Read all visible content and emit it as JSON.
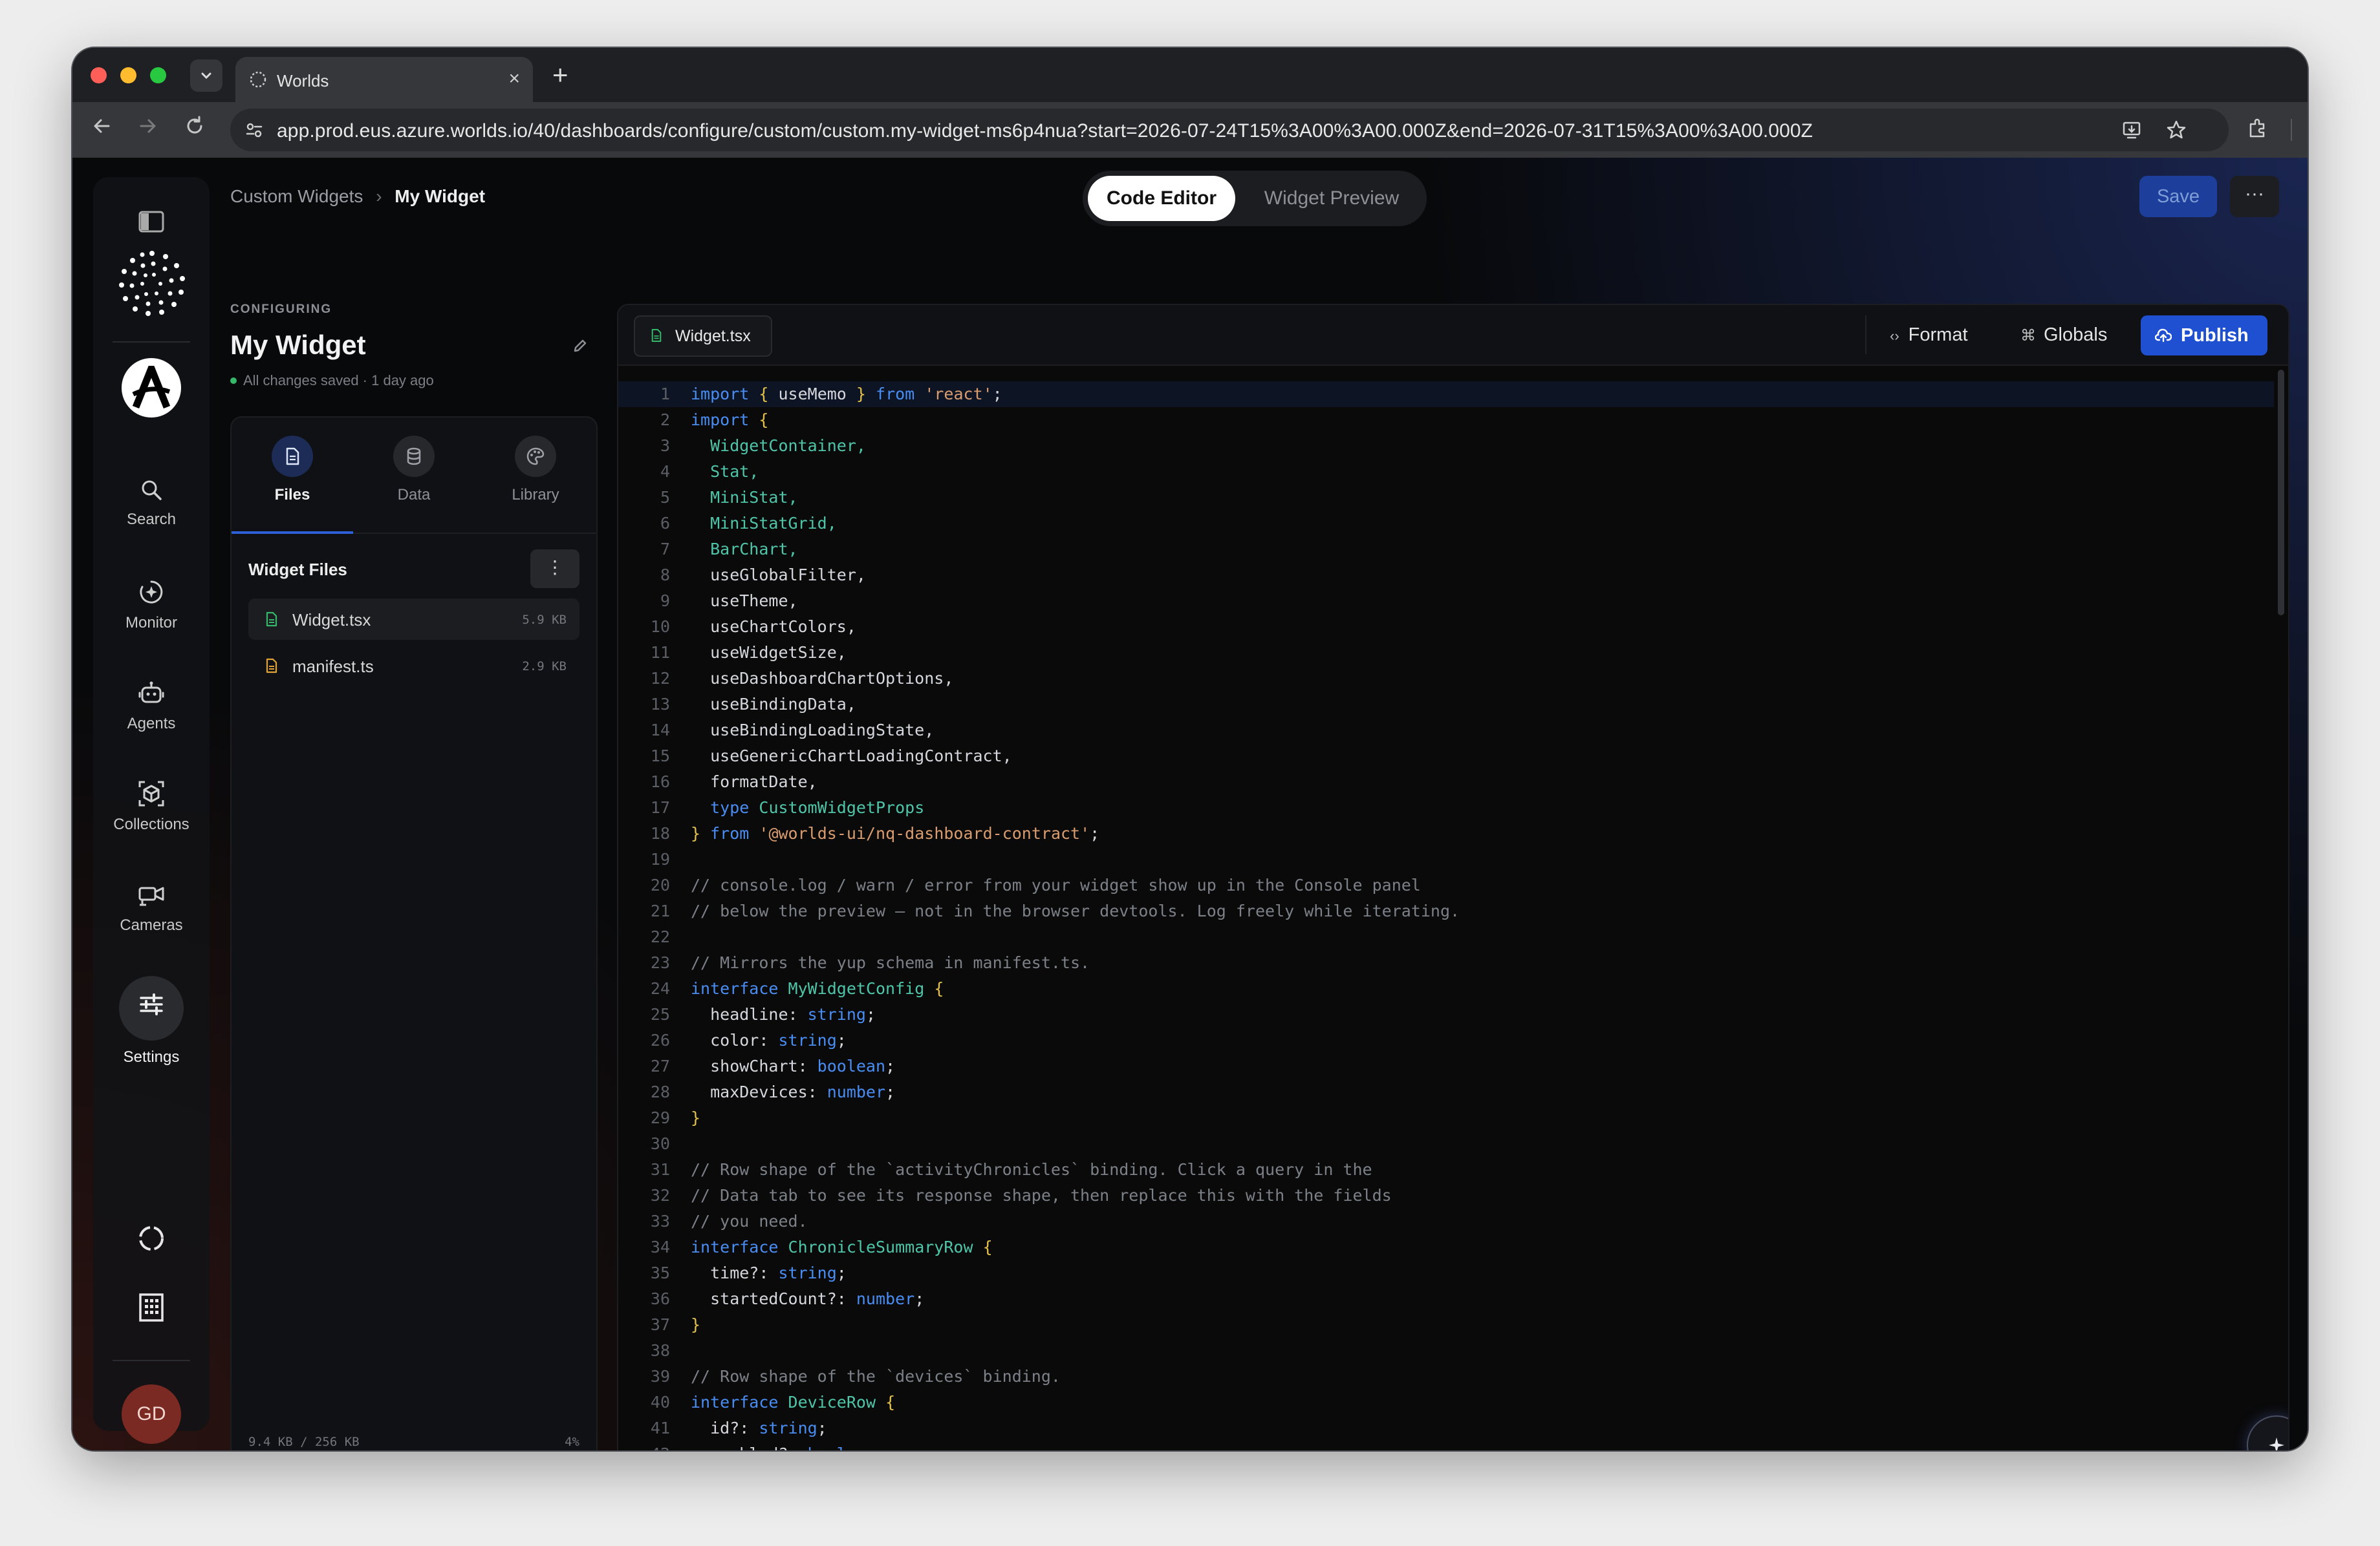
{
  "browser": {
    "tab_title": "Worlds",
    "url": "app.prod.eus.azure.worlds.io/40/dashboards/configure/custom/custom.my-widget-ms6p4nua?start=2026-07-24T15%3A00%3A00.000Z&end=2026-07-31T15%3A00%3A00.000Z"
  },
  "breadcrumb": {
    "parent": "Custom Widgets",
    "separator": "›",
    "current": "My Widget"
  },
  "mode_toggle": {
    "active": "Code Editor",
    "inactive": "Widget Preview"
  },
  "header_actions": {
    "save_label": "Save",
    "more_label": "···"
  },
  "sidebar": {
    "items": [
      {
        "label": "Search",
        "icon": "search-icon"
      },
      {
        "label": "Monitor",
        "icon": "monitor-icon"
      },
      {
        "label": "Agents",
        "icon": "robot-icon"
      },
      {
        "label": "Collections",
        "icon": "collections-icon"
      },
      {
        "label": "Cameras",
        "icon": "camera-icon"
      },
      {
        "label": "Settings",
        "icon": "sliders-icon"
      }
    ],
    "user_initials": "GD"
  },
  "config": {
    "label": "CONFIGURING",
    "title": "My Widget",
    "status": "All changes saved · 1 day ago",
    "status_color": "#35b86a"
  },
  "panel_tabs": [
    {
      "label": "Files",
      "icon": "file-icon",
      "active": true
    },
    {
      "label": "Data",
      "icon": "database-icon",
      "active": false
    },
    {
      "label": "Library",
      "icon": "palette-icon",
      "active": false
    }
  ],
  "widget_files": {
    "title": "Widget Files",
    "more_label": "⋮",
    "files": [
      {
        "name": "Widget.tsx",
        "size": "5.9 KB",
        "selected": true,
        "color": "#35b86a"
      },
      {
        "name": "manifest.ts",
        "size": "2.9 KB",
        "selected": false,
        "color": "#e0a33a"
      }
    ],
    "storage": "9.4 KB / 256 KB",
    "storage_pct": "4%",
    "storage_fraction": 0.04
  },
  "editor": {
    "file_tab": "Widget.tsx",
    "format_label": "Format",
    "globals_label": "Globals",
    "publish_label": "Publish",
    "accent": "#1f50d2"
  },
  "code_lines": [
    "import { useMemo } from 'react';",
    "import {",
    "  WidgetContainer,",
    "  Stat,",
    "  MiniStat,",
    "  MiniStatGrid,",
    "  BarChart,",
    "  useGlobalFilter,",
    "  useTheme,",
    "  useChartColors,",
    "  useWidgetSize,",
    "  useDashboardChartOptions,",
    "  useBindingData,",
    "  useBindingLoadingState,",
    "  useGenericChartLoadingContract,",
    "  formatDate,",
    "  type CustomWidgetProps",
    "} from '@worlds-ui/nq-dashboard-contract';",
    "",
    "// console.log / warn / error from your widget show up in the Console panel",
    "// below the preview — not in the browser devtools. Log freely while iterating.",
    "",
    "// Mirrors the yup schema in manifest.ts.",
    "interface MyWidgetConfig {",
    "  headline: string;",
    "  color: string;",
    "  showChart: boolean;",
    "  maxDevices: number;",
    "}",
    "",
    "// Row shape of the `activityChronicles` binding. Click a query in the",
    "// Data tab to see its response shape, then replace this with the fields",
    "// you need.",
    "interface ChronicleSummaryRow {",
    "  time?: string;",
    "  startedCount?: number;",
    "}",
    "",
    "// Row shape of the `devices` binding.",
    "interface DeviceRow {",
    "  id?: string;",
    "  enabled?: boolean;"
  ]
}
